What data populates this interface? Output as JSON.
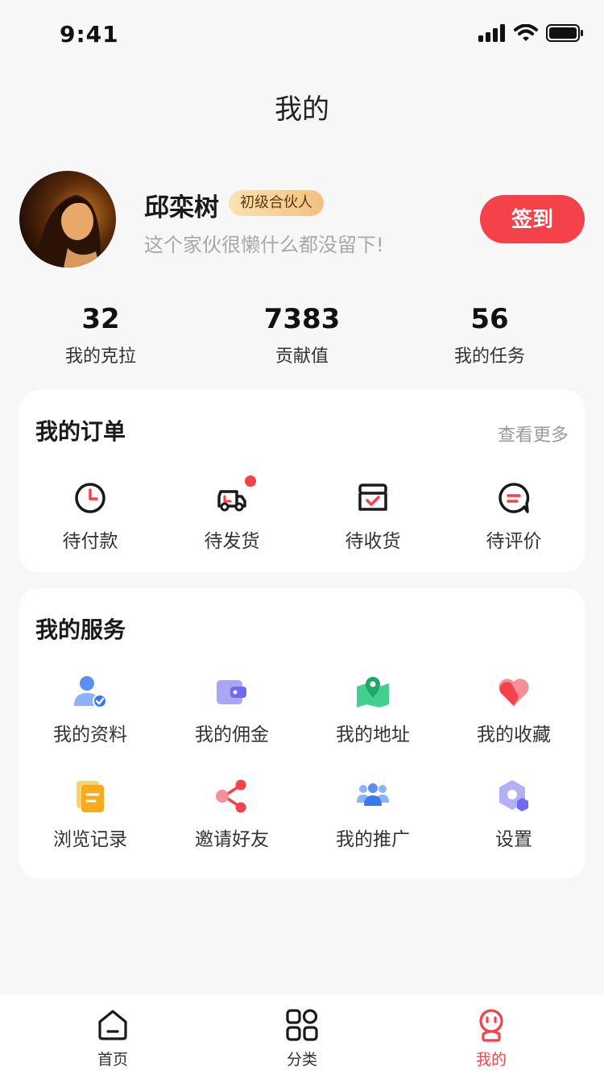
{
  "status_bar": {
    "time": "9:41"
  },
  "nav": {
    "title": "我的"
  },
  "profile": {
    "name": "邱栾树",
    "level_badge": "初级合伙人",
    "bio": "这个家伙很懒什么都没留下!",
    "checkin_label": "签到"
  },
  "stats": [
    {
      "value": "32",
      "label": "我的克拉"
    },
    {
      "value": "7383",
      "label": "贡献值"
    },
    {
      "value": "56",
      "label": "我的任务"
    }
  ],
  "orders": {
    "title": "我的订单",
    "more_label": "查看更多",
    "items": [
      {
        "label": "待付款",
        "icon": "clock-icon"
      },
      {
        "label": "待发货",
        "icon": "truck-icon",
        "badge_dot": true
      },
      {
        "label": "待收货",
        "icon": "box-check-icon"
      },
      {
        "label": "待评价",
        "icon": "comment-icon"
      }
    ]
  },
  "services": {
    "title": "我的服务",
    "items": [
      {
        "label": "我的资料",
        "icon": "user-verified-icon"
      },
      {
        "label": "我的佣金",
        "icon": "wallet-icon"
      },
      {
        "label": "我的地址",
        "icon": "map-pin-icon"
      },
      {
        "label": "我的收藏",
        "icon": "heart-icon"
      },
      {
        "label": "浏览记录",
        "icon": "document-icon"
      },
      {
        "label": "邀请好友",
        "icon": "share-icon"
      },
      {
        "label": "我的推广",
        "icon": "group-icon"
      },
      {
        "label": "设置",
        "icon": "settings-hexagon-icon"
      }
    ]
  },
  "tabbar": {
    "items": [
      {
        "label": "首页",
        "icon": "home-icon",
        "active": false
      },
      {
        "label": "分类",
        "icon": "category-grid-icon",
        "active": false
      },
      {
        "label": "我的",
        "icon": "profile-face-icon",
        "active": true
      }
    ]
  },
  "colors": {
    "accent": "#f5414a",
    "background": "#f7f7f7",
    "card": "#ffffff"
  }
}
